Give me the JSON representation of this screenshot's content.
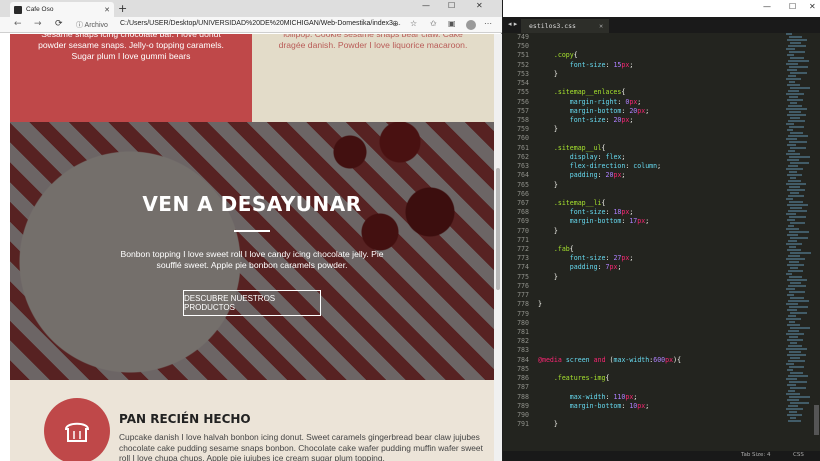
{
  "browser": {
    "tab_title": "Cafe Oso",
    "new_tab": "+",
    "nav": {
      "back": "←",
      "forward": "→",
      "reload": "⟳"
    },
    "address_info": "ⓘ Archivo",
    "url": "C:/Users/USER/Desktop/UNIVERSIDAD%20DE%20MICHIGAN/Web-Domestika/index3....",
    "window_controls": {
      "min": "—",
      "max": "☐",
      "close": "✕"
    }
  },
  "page": {
    "red_cell_text": "Sesame snaps icing chocolate bar. I love donut powder sesame snaps. Jelly-o topping caramels. Sugar plum I love gummi bears",
    "beige_cell_text": "lollipop. Cookie sesame snaps bear claw. Cake dragée danish. Powder I love liquorice macaroon.",
    "hero": {
      "title": "VEN A DESAYUNAR",
      "text": "Bonbon topping I love sweet roll I love candy icing chocolate jelly. Pie soufflé sweet. Apple pie bonbon caramels powder.",
      "button": "DESCUBRE NUESTROS PRODUCTOS"
    },
    "feature": {
      "title": "PAN RECIÉN HECHO",
      "text": "Cupcake danish I love halvah bonbon icing donut. Sweet caramels gingerbread bear claw jujubes chocolate cake pudding sesame snaps bonbon. Chocolate cake wafer pudding muffin wafer sweet roll I love chupa chups. Apple pie jujubes ice cream sugar plum topping."
    }
  },
  "editor": {
    "file_tab": "estilos3.css",
    "line_numbers": [
      "749",
      "750",
      "751",
      "752",
      "753",
      "754",
      "755",
      "756",
      "757",
      "758",
      "759",
      "760",
      "761",
      "762",
      "763",
      "764",
      "765",
      "766",
      "767",
      "768",
      "769",
      "770",
      "771",
      "772",
      "773",
      "774",
      "775",
      "776",
      "777",
      "778",
      "779",
      "780",
      "781",
      "782",
      "783",
      "784",
      "785",
      "786",
      "787",
      "788",
      "789",
      "790",
      "791"
    ],
    "status": {
      "tab_size": "Tab Size: 4",
      "syntax": "CSS"
    }
  },
  "left_strip": [
    "E",
    "re",
    "M",
    "F"
  ],
  "colors": {
    "red": "#bf4849",
    "beige": "#e3dcc9",
    "feature_bg": "#ece4d8",
    "editor_bg": "#23241f"
  }
}
